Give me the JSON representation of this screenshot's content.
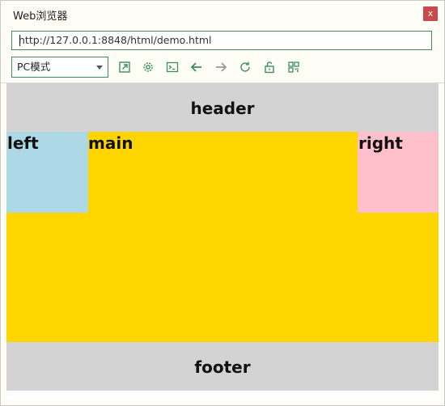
{
  "window": {
    "title": "Web浏览器",
    "close_label": "x"
  },
  "address_bar": {
    "url": "http://127.0.0.1:8848/html/demo.html"
  },
  "toolbar": {
    "mode_select": {
      "selected": "PC模式"
    },
    "icons": [
      {
        "name": "open-external-icon"
      },
      {
        "name": "settings-gear-icon"
      },
      {
        "name": "console-icon"
      },
      {
        "name": "back-arrow-icon"
      },
      {
        "name": "forward-arrow-icon"
      },
      {
        "name": "reload-icon"
      },
      {
        "name": "unlock-icon"
      },
      {
        "name": "qr-code-icon"
      }
    ],
    "accent_color": "#3a8f5c"
  },
  "page": {
    "header": {
      "text": "header",
      "color": "#d3d3d3"
    },
    "left": {
      "text": "left",
      "color": "#add8e6"
    },
    "main": {
      "text": "main",
      "color": "#ffd500"
    },
    "right": {
      "text": "right",
      "color": "#ffc0cb"
    },
    "footer": {
      "text": "footer",
      "color": "#d3d3d3"
    }
  }
}
